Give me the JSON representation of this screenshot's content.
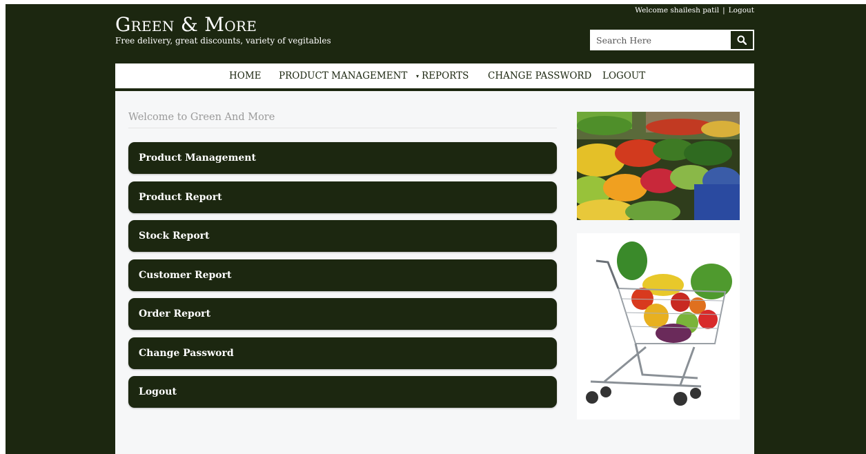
{
  "header": {
    "welcome_text": "Welcome shailesh patil",
    "separator": "|",
    "logout_link": "Logout",
    "logo": "Green & More",
    "tagline": "Free delivery, great discounts, variety of vegitables",
    "search_placeholder": "Search Here",
    "search_icon": "search-icon"
  },
  "nav": {
    "items": [
      "HOME",
      "PRODUCT MANAGEMENT",
      "REPORTS",
      "CHANGE PASSWORD",
      "LOGOUT"
    ],
    "reports_caret": "▾"
  },
  "main": {
    "welcome_heading": "Welcome to Green And More",
    "menu": [
      "Product Management",
      "Product Report",
      "Stock Report",
      "Customer Report",
      "Order Report",
      "Change Password",
      "Logout"
    ]
  },
  "colors": {
    "background": "#1c2710",
    "panel": "#f6f7f8",
    "button": "#1c2710",
    "text_light": "#ffffff",
    "muted": "#9a9a9a"
  }
}
